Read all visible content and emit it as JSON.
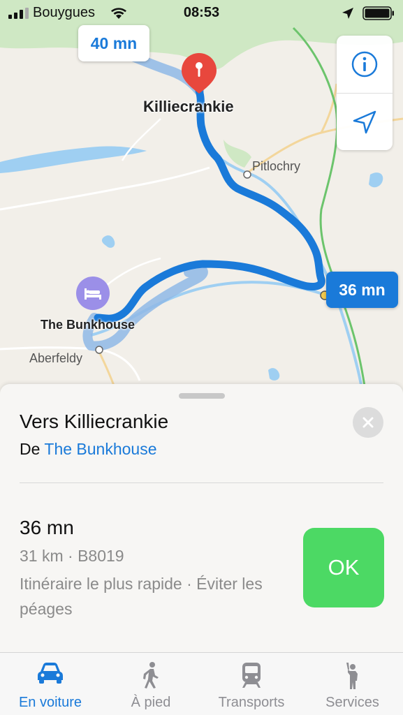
{
  "status_bar": {
    "carrier": "Bouygues",
    "time": "08:53"
  },
  "map": {
    "callout_alt_route": "40 mn",
    "callout_main_route": "36 mn",
    "destination_label": "Killiecrankie",
    "town_pitlochry": "Pitlochry",
    "origin_label": "The Bunkhouse",
    "town_aberfeldy": "Aberfeldy",
    "controls": {
      "info_icon": "info-icon",
      "locate_icon": "location-arrow-icon"
    },
    "colors": {
      "route": "#1a7ad9",
      "pin": "#e8473d",
      "hotel_pin": "#9b8fe8"
    }
  },
  "sheet": {
    "title": "Vers Killiecrankie",
    "from_prefix": "De",
    "from_place": "The Bunkhouse",
    "route": {
      "duration": "36 mn",
      "distance_road": "31 km · B8019",
      "note": "Itinéraire le plus rapide · Éviter les péages"
    },
    "ok_label": "OK",
    "ok_color": "#4cd964"
  },
  "tabs": [
    {
      "label": "En voiture",
      "icon": "car-icon",
      "active": true
    },
    {
      "label": "À pied",
      "icon": "walking-icon",
      "active": false
    },
    {
      "label": "Transports",
      "icon": "train-icon",
      "active": false
    },
    {
      "label": "Services",
      "icon": "hailing-person-icon",
      "active": false
    }
  ]
}
